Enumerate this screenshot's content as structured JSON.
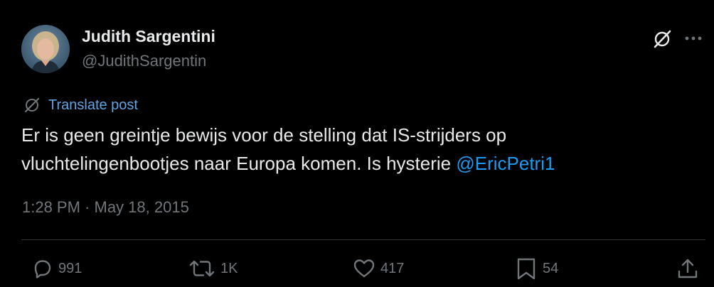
{
  "author": {
    "display_name": "Judith Sargentini",
    "handle": "@JudithSargentin"
  },
  "translate": {
    "label": "Translate post"
  },
  "post": {
    "text_line1": "Er is geen greintje bewijs voor de stelling dat IS-strijders op",
    "text_line2": "vluchtelingenbootjes naar Europa komen. Is hysterie ",
    "mention": "@EricPetri1"
  },
  "timestamp": {
    "time": "1:28 PM",
    "separator": " · ",
    "date": "May 18, 2015"
  },
  "actions": {
    "replies": "991",
    "reposts": "1K",
    "likes": "417",
    "bookmarks": "54"
  },
  "icons": {
    "grok": "grok-icon",
    "more": "more-icon",
    "translate": "translate-icon",
    "reply": "reply-icon",
    "repost": "repost-icon",
    "like": "like-icon",
    "bookmark": "bookmark-icon",
    "share": "share-icon"
  },
  "colors": {
    "background": "#000000",
    "primary_text": "#e7e9ea",
    "secondary_text": "#71767b",
    "link": "#1d9bf0",
    "translate_link": "#5fa6e6",
    "divider": "#2f3336"
  }
}
